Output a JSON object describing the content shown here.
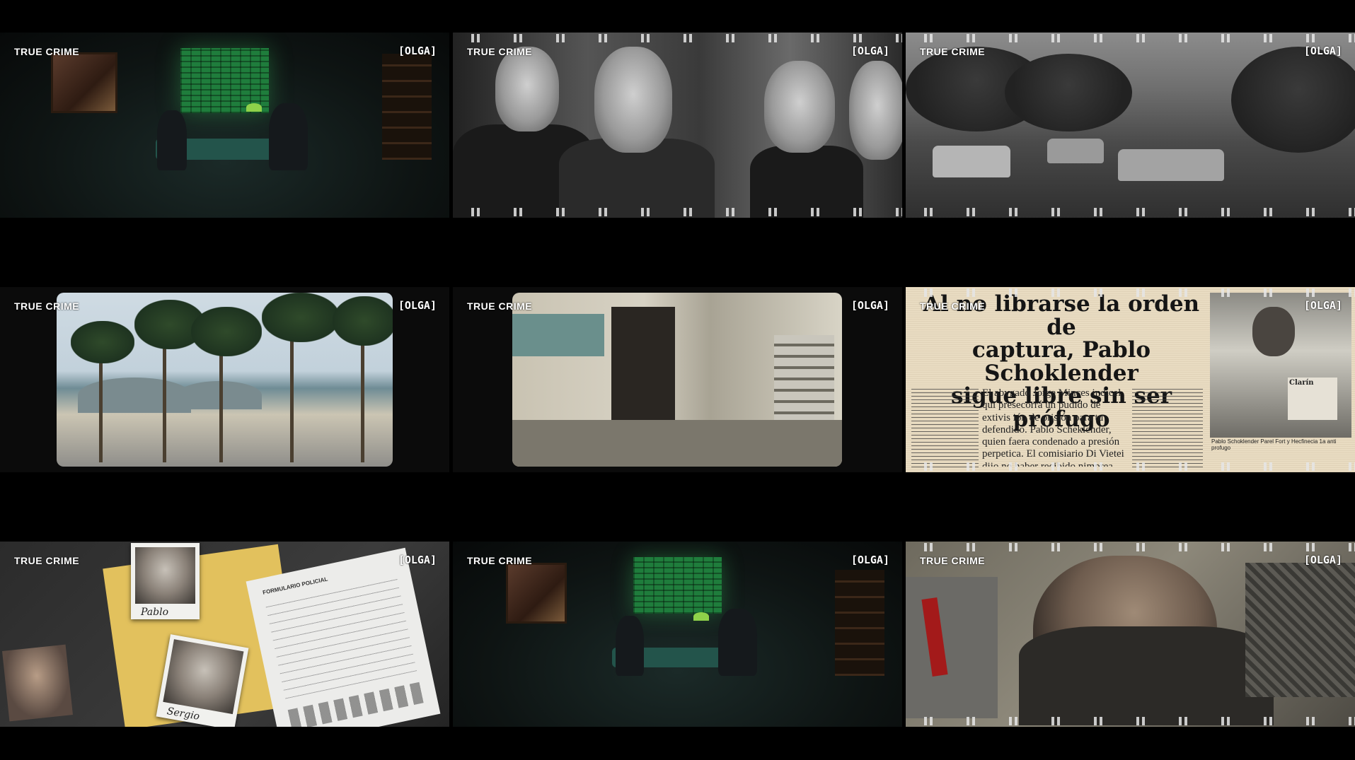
{
  "brand": "TRUE CRIME",
  "tag": "[OLGA]",
  "newspaper": {
    "headline_lines": [
      "Al no librarse la orden de",
      "captura, Pablo Schoklender",
      "sigue libre sin ser prófugo"
    ],
    "body_text": "El abvgado Jorge Minces indicel qui presecorrá un pudido de extivis ión de prisión para tu defendido. Pablo Scheklender, quien faera condenado a presión perpetica. El comisiario Di Vietei dijo no haber recibido nimprea orden de captura. Para la Justicia, no",
    "caption": "Pablo Schoklender Parel Fort y Hecfinecia 1a anti profugo",
    "clipping_label": "Clarín"
  },
  "desk": {
    "form_title": "FORMULARIO POLICIAL",
    "photo1_label": "Pablo",
    "photo2_label": "Sergio"
  }
}
